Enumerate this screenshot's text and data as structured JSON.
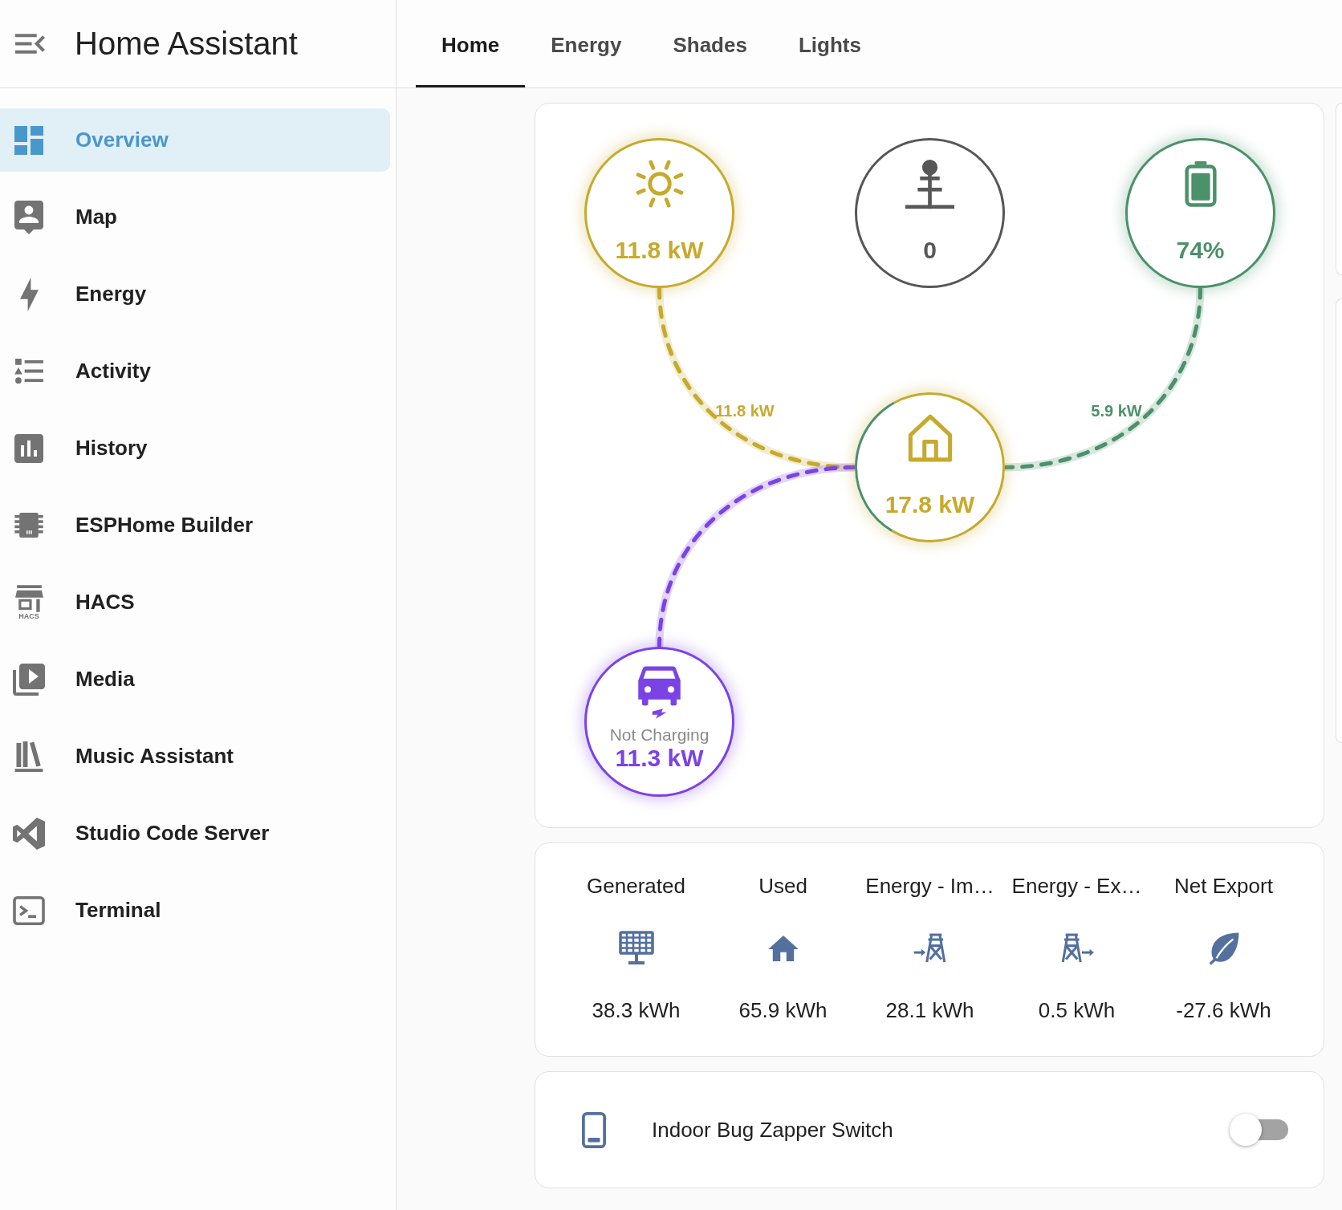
{
  "sidebar": {
    "title": "Home Assistant",
    "items": [
      {
        "label": "Overview",
        "selected": true
      },
      {
        "label": "Map",
        "selected": false
      },
      {
        "label": "Energy",
        "selected": false
      },
      {
        "label": "Activity",
        "selected": false
      },
      {
        "label": "History",
        "selected": false
      },
      {
        "label": "ESPHome Builder",
        "selected": false
      },
      {
        "label": "HACS",
        "selected": false,
        "icon_caption": "HACS"
      },
      {
        "label": "Media",
        "selected": false
      },
      {
        "label": "Music Assistant",
        "selected": false
      },
      {
        "label": "Studio Code Server",
        "selected": false
      },
      {
        "label": "Terminal",
        "selected": false
      }
    ]
  },
  "tabs": [
    {
      "label": "Home",
      "selected": true
    },
    {
      "label": "Energy",
      "selected": false
    },
    {
      "label": "Shades",
      "selected": false
    },
    {
      "label": "Lights",
      "selected": false
    }
  ],
  "energy_flow": {
    "nodes": [
      {
        "kind": "solar",
        "value": "11.8 kW",
        "color": "#c6aa2d",
        "active": true
      },
      {
        "kind": "grid",
        "value": "0",
        "color": "#575757",
        "active": false
      },
      {
        "kind": "battery",
        "value": "74%",
        "color": "#4b916a",
        "active": true
      },
      {
        "kind": "home",
        "value": "17.8 kW",
        "color": "#c6aa2d",
        "active": true
      },
      {
        "kind": "ev",
        "state": "Not Charging",
        "value": "11.3 kW",
        "color": "#7b42e6",
        "active": true
      }
    ],
    "flows": [
      {
        "kind": "solar",
        "value": "11.8 kW",
        "color": "#c6aa2d"
      },
      {
        "kind": "battery",
        "value": "5.9 kW",
        "color": "#4b916a"
      },
      {
        "kind": "ev",
        "color": "#7b42e6"
      }
    ]
  },
  "energy_stats": [
    {
      "label": "Generated",
      "value": "38.3 kWh"
    },
    {
      "label": "Used",
      "value": "65.9 kWh"
    },
    {
      "label": "Energy - Im…",
      "value": "28.1 kWh"
    },
    {
      "label": "Energy - Ex…",
      "value": "0.5 kWh"
    },
    {
      "label": "Net Export",
      "value": "-27.6 kWh"
    }
  ],
  "switch": {
    "label": "Indoor Bug Zapper Switch",
    "on": false
  }
}
